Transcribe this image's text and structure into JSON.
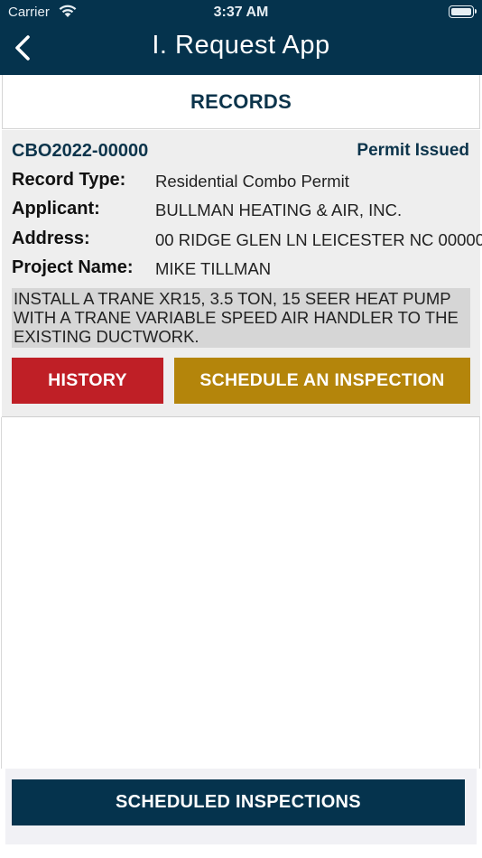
{
  "status_bar": {
    "carrier": "Carrier",
    "time": "3:37 AM",
    "wifi_icon": "wifi-icon",
    "battery_icon": "battery-icon"
  },
  "nav": {
    "title": "I. Request App",
    "back_icon": "chevron-left-icon"
  },
  "section": {
    "title": "RECORDS"
  },
  "record": {
    "id": "CBO2022-00000",
    "status": "Permit Issued",
    "fields": [
      {
        "label": "Record Type:",
        "value": "Residential Combo Permit"
      },
      {
        "label": "Applicant:",
        "value": "BULLMAN HEATING & AIR, INC."
      },
      {
        "label": "Address:",
        "value": "00 RIDGE GLEN LN LEICESTER NC 00000"
      },
      {
        "label": "Project Name:",
        "value": "MIKE TILLMAN"
      }
    ],
    "description": "INSTALL A TRANE XR15, 3.5 TON, 15 SEER HEAT PUMP WITH A TRANE VARIABLE SPEED AIR HANDLER TO THE EXISTING DUCTWORK."
  },
  "actions": {
    "history_label": "HISTORY",
    "schedule_label": "SCHEDULE AN INSPECTION",
    "scheduled_inspections_label": "SCHEDULED INSPECTIONS"
  },
  "colors": {
    "navy": "#05334d",
    "history_red": "#bf1f26",
    "schedule_gold": "#b4850b",
    "card_bg": "#eeeeee"
  }
}
